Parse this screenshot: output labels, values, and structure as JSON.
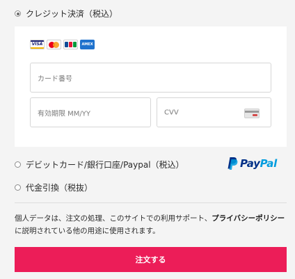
{
  "payment_options": {
    "credit": {
      "label": "クレジット決済（税込）",
      "selected": true
    },
    "debit": {
      "label": "デビットカード/銀行口座/Paypal（税込）",
      "selected": false
    },
    "cod": {
      "label": "代金引換（税抜）",
      "selected": false
    }
  },
  "card_form": {
    "brands": {
      "visa": "VISA",
      "mastercard": "mastercard-icon",
      "jcb": "jcb-icon",
      "amex": "AMEX"
    },
    "card_number_placeholder": "カード番号",
    "expiry_placeholder": "有効期限 MM/YY",
    "cvv_placeholder": "CVV"
  },
  "paypal_logo": {
    "pay": "Pay",
    "pal": "Pal"
  },
  "privacy": {
    "line1_prefix": "個人データは、注文の処理、このサイトでの利用サポート、",
    "link_text": "プライバシーポリシー",
    "line2": "に説明されている他の用途に使用されます。"
  },
  "submit_label": "注文する",
  "colors": {
    "accent": "#ec1d58",
    "paypal_dark": "#003087",
    "paypal_light": "#009cde"
  }
}
